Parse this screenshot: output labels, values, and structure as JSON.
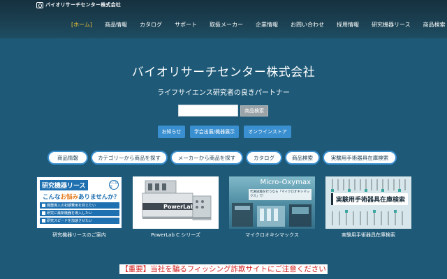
{
  "header": {
    "logo_text": "バイオリサーチセンター株式会社",
    "nav": [
      "[ホーム]",
      "商品情報",
      "カタログ",
      "サポート",
      "取扱メーカー",
      "企業情報",
      "お問い合わせ",
      "採用情報",
      "研究機器リース",
      "商品検索"
    ]
  },
  "hero": {
    "title": "バイオリサーチセンター株式会社",
    "subtitle": "ライフサイエンス研究者の良きパートナー"
  },
  "search": {
    "placeholder": "",
    "button": "商品検索"
  },
  "quick_buttons": [
    "お知らせ",
    "学会出展/機器展示",
    "オンラインストア"
  ],
  "pills": [
    "商品情報",
    "カテゴリーから商品を探す",
    "メーカーから商品を探す",
    "カタログ",
    "商品検索",
    "実験用手術器具在庫検索"
  ],
  "cards": [
    {
      "caption": "研究機器リースのご案内",
      "banner_title": "研究機器リース",
      "banner_tag": "のご提案",
      "question_pre": "こんな",
      "question_hl": "お悩み",
      "question_post": "ありませんか？",
      "list": [
        "機器導入の初期費用を抑えたい",
        "研究に最新機器を導入したい",
        "研究スピードを加速させたい"
      ]
    },
    {
      "caption": "PowerLab C シリーズ",
      "brand": "PowerLab"
    },
    {
      "caption": "マイクロオキシマックス",
      "banner_title": "Micro-Oxymax",
      "banner_note": "代謝試験を行うなら「マイクロオキシマックス」で!"
    },
    {
      "caption": "実験用手術器具在庫検索",
      "banner_title": "実験用手術器具在庫検索"
    }
  ],
  "warning": "【重要】当社を騙るフィッシング詐欺サイトにご注意ください",
  "colors": {
    "background": "#1e5a78",
    "accent_blue": "#3a8fd0",
    "nav_active": "#f1c232",
    "warning_red": "#d32020"
  }
}
